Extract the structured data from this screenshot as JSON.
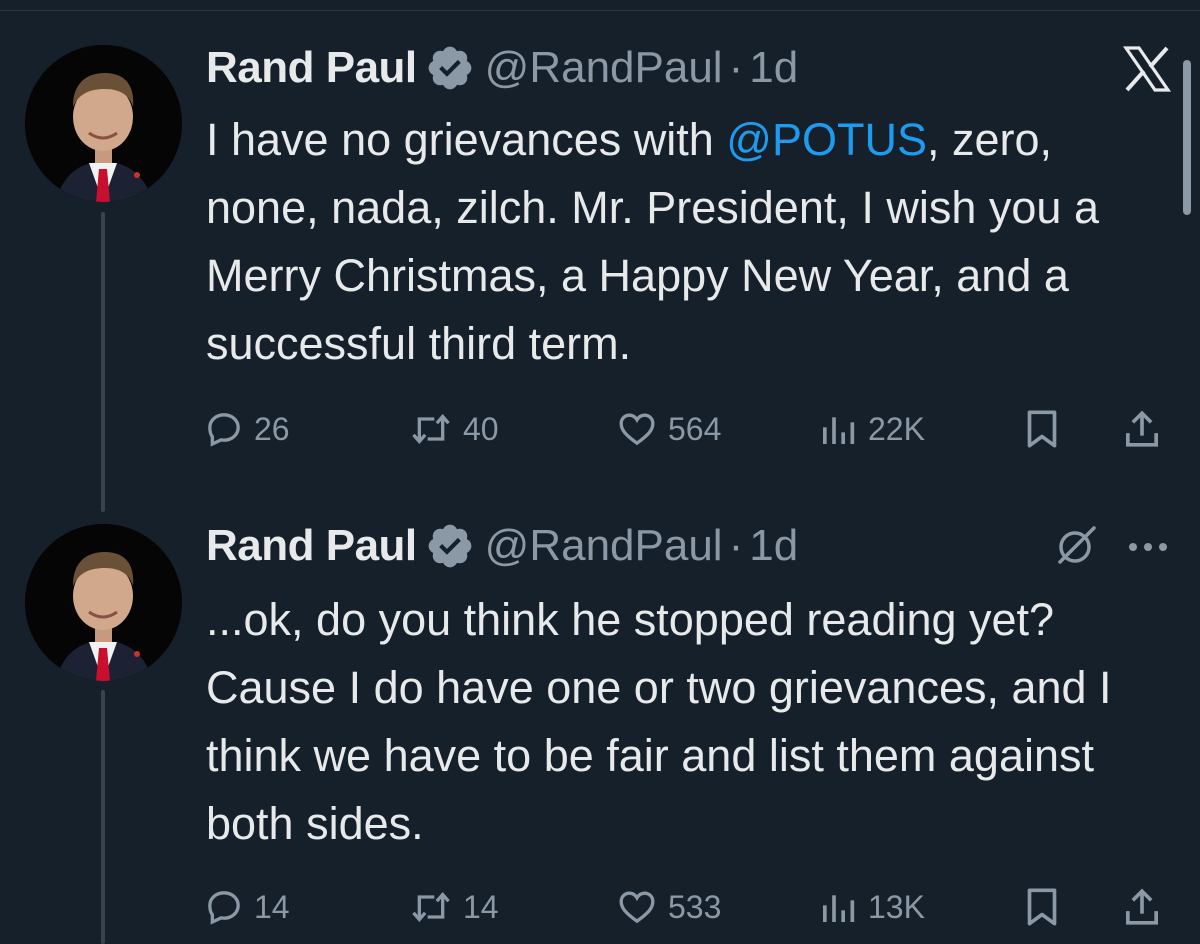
{
  "colors": {
    "background": "#15202b",
    "primary_text": "#e7e9ea",
    "secondary_text": "#8b98a5",
    "mention": "#1d9bf0",
    "verified_badge": "#8b98a5",
    "thread_line": "#38444d"
  },
  "header": {
    "platform_icon": "x-logo-icon"
  },
  "tweets": [
    {
      "author": {
        "name": "Rand Paul",
        "handle": "@RandPaul",
        "verified": true
      },
      "separator": "·",
      "age": "1d",
      "text": {
        "before_mention": "I have no grievances with ",
        "mention": "@POTUS",
        "after_mention": ", zero, none, nada, zilch. Mr. President, I wish you a Merry Christmas, a Happy New Year, and a successful third term."
      },
      "stats": {
        "replies": "26",
        "retweets": "40",
        "likes": "564",
        "views": "22K"
      }
    },
    {
      "author": {
        "name": "Rand Paul",
        "handle": "@RandPaul",
        "verified": true
      },
      "separator": "·",
      "age": "1d",
      "text": {
        "body": "...ok, do you think he stopped reading yet? Cause I do have one or two grievances, and I think we have to be fair and list them against both sides."
      },
      "stats": {
        "replies": "14",
        "retweets": "14",
        "likes": "533",
        "views": "13K"
      },
      "menu_icons": [
        "grok-icon",
        "more-options-icon"
      ]
    }
  ]
}
